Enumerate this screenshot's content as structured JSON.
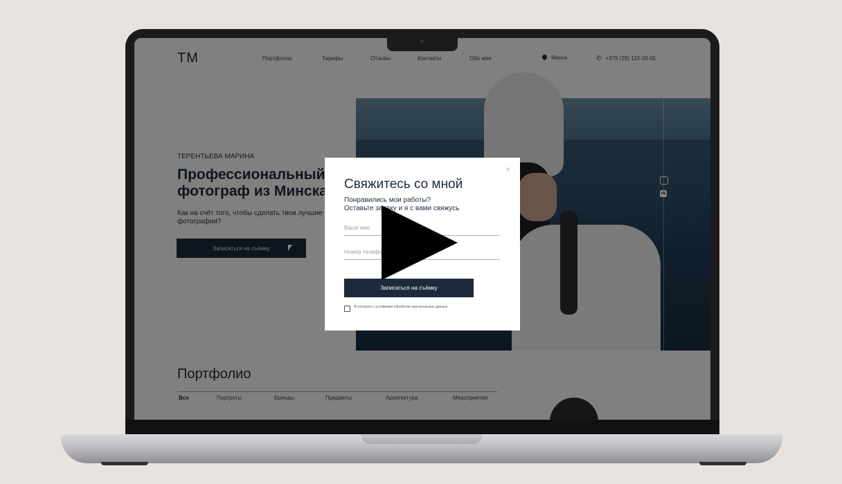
{
  "site": {
    "logo": "TM",
    "nav": [
      "Портфолио",
      "Тарифы",
      "Отзывы",
      "Контакты",
      "Обо мне"
    ],
    "location": "Минск",
    "phone": "+375 (29) 110-26-55"
  },
  "hero": {
    "eyebrow": "ТЕРЕНТЬЕВА МАРИНА",
    "title": "Профессиональный\nфотограф из Минска",
    "subtitle": "Как на счёт того, чтобы сделать твои лучшие фотографии?",
    "button_label": "Записаться на съёмку"
  },
  "portfolio": {
    "title": "Портфолио",
    "filters": [
      "Все",
      "Портреты",
      "Бренды",
      "Предметы",
      "Архитектура",
      "Мероприятия"
    ],
    "active_filter": "Все"
  },
  "modal": {
    "title": "Свяжитесь со мной",
    "subtitle_line1": "Понравились мои работы?",
    "subtitle_line2": "Оставьте заявку и я с вами свяжусь",
    "name_placeholder": "Ваше имя",
    "phone_placeholder": "Номер телефона",
    "submit_label": "Записаться на съёмку",
    "consent": "Я согласен с условиями обработки персональных данных",
    "close_glyph": "×"
  },
  "colors": {
    "accent": "#1c2a3c",
    "background": "#e8e3df"
  },
  "icons": [
    "pin-icon",
    "phone-icon",
    "instagram-icon",
    "vk-icon",
    "close-icon",
    "play-icon",
    "cursor-icon"
  ]
}
